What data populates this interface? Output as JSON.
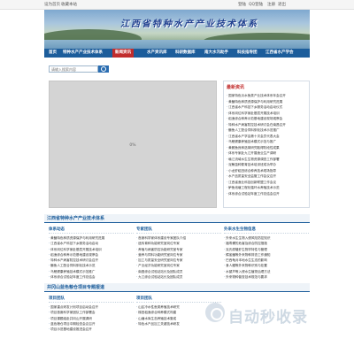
{
  "topbar": {
    "set_home": "设为首页",
    "add_favorite": "收藏本站",
    "login": "登陆",
    "qq_login": "QQ登陆",
    "register": "注册",
    "logout": "退出"
  },
  "banner": {
    "title": "江西省特种水产产业技术体系"
  },
  "nav": {
    "items": [
      "首页",
      "特种水产产业技术体系",
      "新闻资讯",
      "水产资讯库",
      "科研数据库",
      "南大水汛助手",
      "科技指导团",
      "江西省水产学会"
    ],
    "active_index": 2
  },
  "search": {
    "placeholder": "请输入搜索内容"
  },
  "slider": {
    "progress_text": "0%"
  },
  "news": {
    "title": "最新资讯",
    "items": [
      "国家特色淡水鱼类产业技术体系年会召开",
      "黄鳝特色种质资源保护与利用研究进展",
      "江西省水产科技下乡服务活动启动仪式",
      "体系岗位科学家赴基层开展技术培训",
      "稻渔综合种养示范基地建设现场观摩会",
      "特种水产病害防控技术研讨会在南昌召开",
      "鳜鱼人工配合饲料驯化技术示范推广",
      "江西省水产学会第十次会员代表大会",
      "乌鳢健康养殖技术模式示范与推广",
      "黄颡鱼良种选育研究取得阶段性成果",
      "体系专家赴九江开展渔业生产调研",
      "赣江流域水生生物资源调查工作部署",
      "泥鳅苗种繁育技术培训班成功举办",
      "小龙虾稻田综合种养技术现场指导",
      "水产品质量安全监管工作会议召开",
      "江西省渔业科技创新联盟工作会议",
      "鲈鱼池塘工程化循环水养殖技术示范",
      "体系综合试验站年度工作总结会召开"
    ]
  },
  "system_section": {
    "title": "江西省特种水产产业技术体系",
    "columns": [
      {
        "heading": "体系动态",
        "items": [
          "黄鳝特色种质资源保护与利用研究进展",
          "江西省水产科技下乡服务活动启动",
          "体系岗位科学家赴基层开展技术培训",
          "稻渔综合种养示范基地建设观摩会",
          "特种水产病害防控技术研讨会召开",
          "鳜鱼人工配合饲料驯化技术示范",
          "乌鳢健康养殖技术模式示范推广",
          "体系综合试验站年度工作总结会"
        ]
      },
      {
        "heading": "专家团队",
        "items": [
          "首席科学家体系建设专家团队介绍",
          "遗传育种功能研究室岗位专家",
          "养殖与病害防控功能研究室专家",
          "营养与饲料功能研究室岗位专家",
          "加工与质量安全研究室岗位专家",
          "产业经济功能研究室岗位专家",
          "南昌综合试验站站长及团队成员",
          "九江综合试验站站长及团队成员"
        ]
      },
      {
        "heading": "外来水生生物信息",
        "items": [
          "外来水生生物入侵风险防控知识",
          "福寿螺的危害及综合防控措施",
          "克氏原螯虾生物学特性与管理",
          "鳄雀鳝等外来物种排查工作通知",
          "巴西龟对本地水生生态的影响",
          "食人鲳等外来物种识别与处置",
          "水葫芦等入侵水生植物治理方法",
          "外来物种普查技术规范与要求"
        ]
      }
    ]
  },
  "project_section": {
    "title": "井冈山蓝色粮仓项目专题报道",
    "columns": [
      {
        "heading": "项目团队",
        "items": [
          "国家重点研发计划项目启动会召开",
          "项目首席科学家团队工作部署会",
          "项目课题组赴井冈山开展调研",
          "蓝色粮仓项目中期检查会议召开",
          "项目示范基地建设推进会召开"
        ]
      },
      {
        "heading": "项目团队",
        "items": [
          "山区冷水性鱼类养殖技术研究",
          "梯田稻渔综合种养模式构建",
          "山塘水库生态养殖技术集成",
          "特色水产品加工关键技术研发"
        ]
      }
    ]
  }
}
